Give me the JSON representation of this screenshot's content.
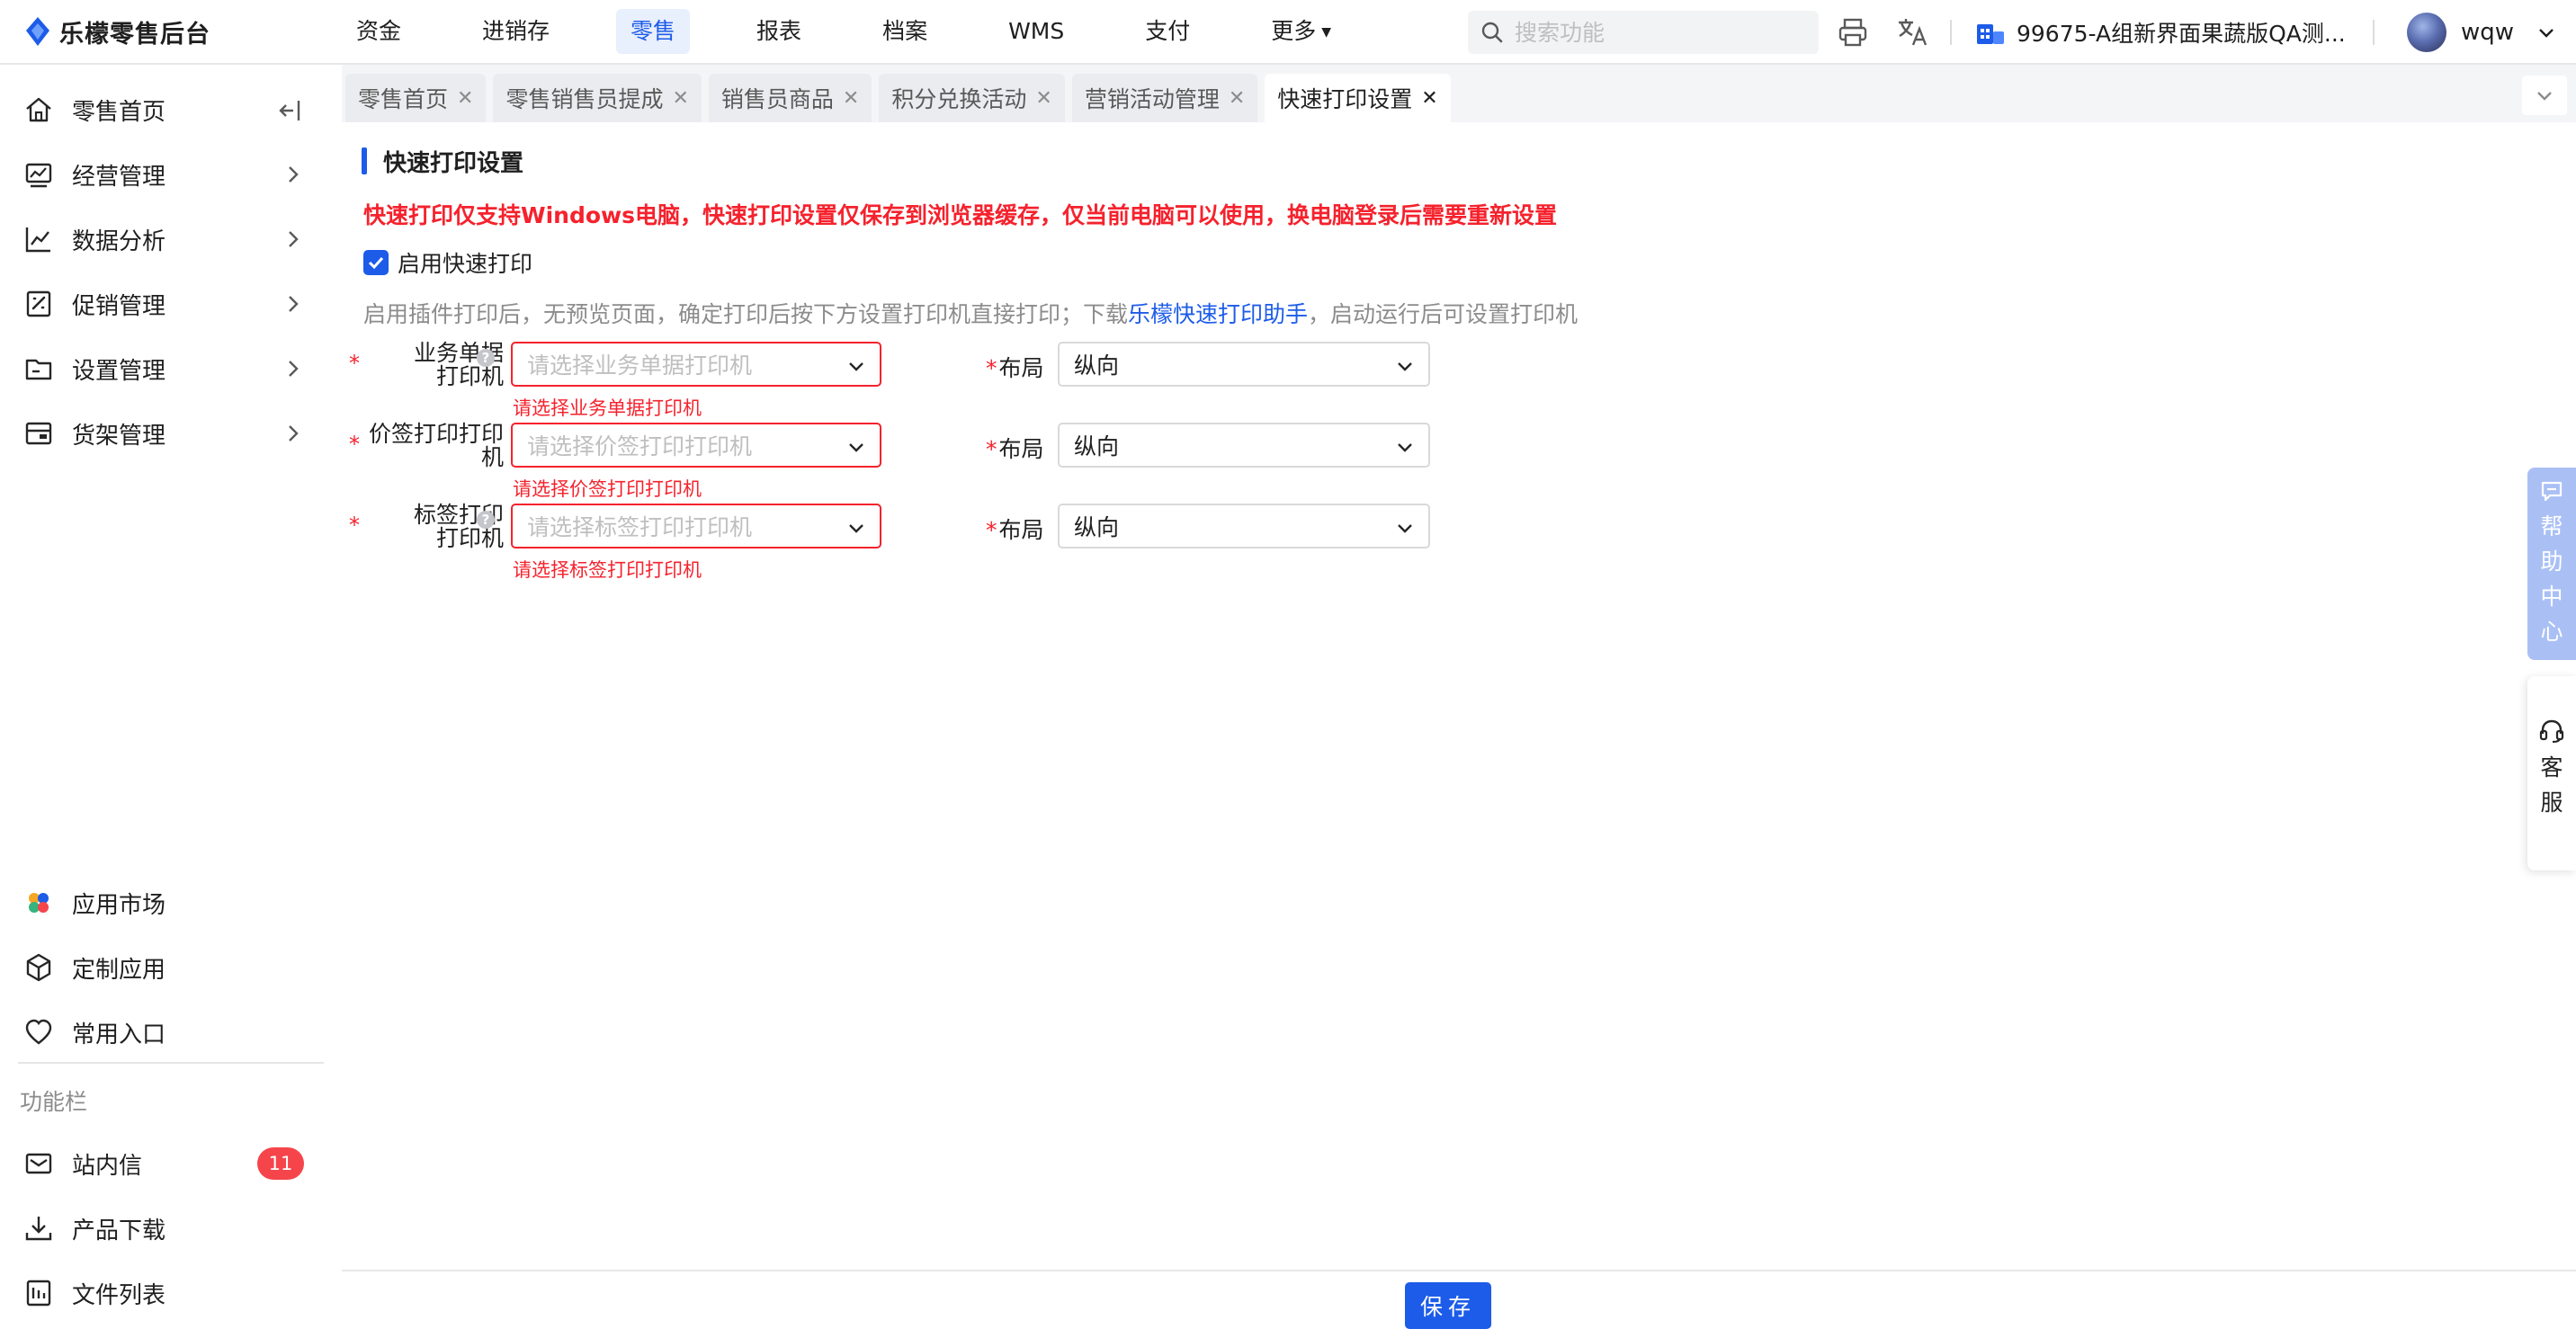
{
  "header": {
    "app_name": "乐檬零售后台",
    "nav": [
      {
        "label": "资金"
      },
      {
        "label": "进销存"
      },
      {
        "label": "零售",
        "active": true
      },
      {
        "label": "报表"
      },
      {
        "label": "档案"
      },
      {
        "label": "WMS"
      },
      {
        "label": "支付"
      },
      {
        "label": "更多"
      }
    ],
    "search_placeholder": "搜索功能",
    "store_name": "99675-A组新界面果蔬版QA测...",
    "user_name": "wqw",
    "accent_color": "#1d5ce8"
  },
  "sidebar": {
    "items": [
      {
        "label": "零售首页",
        "icon": "home-icon"
      },
      {
        "label": "经营管理",
        "icon": "dashboard-icon"
      },
      {
        "label": "数据分析",
        "icon": "line-chart-icon"
      },
      {
        "label": "促销管理",
        "icon": "promotion-icon"
      },
      {
        "label": "设置管理",
        "icon": "folder-icon"
      },
      {
        "label": "货架管理",
        "icon": "shelf-icon"
      }
    ],
    "bottom_items": [
      {
        "label": "应用市场",
        "icon": "app-market-icon"
      },
      {
        "label": "定制应用",
        "icon": "cube-icon"
      },
      {
        "label": "常用入口",
        "icon": "heart-icon"
      }
    ],
    "section_title": "功能栏",
    "func_items": [
      {
        "label": "站内信",
        "icon": "mail-icon",
        "badge": "11"
      },
      {
        "label": "产品下载",
        "icon": "download-icon"
      },
      {
        "label": "文件列表",
        "icon": "file-list-icon"
      }
    ]
  },
  "tabs": [
    {
      "label": "零售首页"
    },
    {
      "label": "零售销售员提成"
    },
    {
      "label": "销售员商品"
    },
    {
      "label": "积分兑换活动"
    },
    {
      "label": "营销活动管理"
    },
    {
      "label": "快速打印设置",
      "active": true
    }
  ],
  "page": {
    "title": "快速打印设置",
    "warning": "快速打印仅支持Windows电脑，快速打印设置仅保存到浏览器缓存，仅当前电脑可以使用，换电脑登录后需要重新设置",
    "enable_label": "启用快速打印",
    "enable_checked": true,
    "hint_prefix": "启用插件打印后，无预览页面，确定打印后按下方设置打印机直接打印；下载",
    "hint_link": "乐檬快速打印助手",
    "hint_suffix": "，启动运行后可设置打印机",
    "rows": [
      {
        "label_line1": "业务单据",
        "label_line2": "打印机",
        "has_help": true,
        "placeholder": "请选择业务单据打印机",
        "error": "请选择业务单据打印机",
        "layout_label": "布局",
        "layout_value": "纵向"
      },
      {
        "label_line1": "价签打印打印",
        "label_line2": "机",
        "has_help": false,
        "placeholder": "请选择价签打印打印机",
        "error": "请选择价签打印打印机",
        "layout_label": "布局",
        "layout_value": "纵向"
      },
      {
        "label_line1": "标签打印",
        "label_line2": "打印机",
        "has_help": true,
        "placeholder": "请选择标签打印打印机",
        "error": "请选择标签打印打印机",
        "layout_label": "布局",
        "layout_value": "纵向"
      }
    ],
    "save_label": "保存"
  },
  "float": {
    "help_chars": [
      "帮",
      "助",
      "中",
      "心"
    ],
    "service_chars": [
      "客",
      "服"
    ]
  },
  "colors": {
    "accent": "#1d5ce8",
    "error": "#f5222d",
    "badge": "#f5454b",
    "help_tab": "#aac0f5"
  }
}
